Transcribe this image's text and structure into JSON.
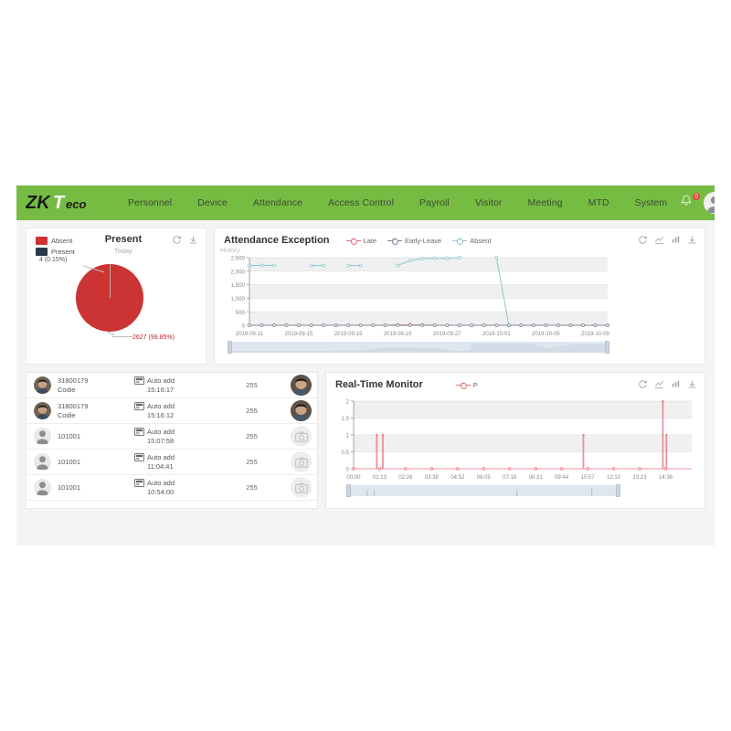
{
  "brand": {
    "name": "ZKTeco",
    "green": "#76bc43"
  },
  "nav": {
    "items": [
      {
        "label": "Personnel"
      },
      {
        "label": "Device"
      },
      {
        "label": "Attendance"
      },
      {
        "label": "Access Control"
      },
      {
        "label": "Payroll"
      },
      {
        "label": "Visitor"
      },
      {
        "label": "Meeting"
      },
      {
        "label": "MTD"
      },
      {
        "label": "System"
      }
    ],
    "notification_count": "0"
  },
  "present_card": {
    "title": "Present",
    "subtitle": "Today",
    "legend": [
      {
        "label": "Absent",
        "color": "#cc3333"
      },
      {
        "label": "Present",
        "color": "#2b3a4a"
      }
    ],
    "labels": {
      "small": "4 (0.15%)",
      "large": "2627 (99.85%)"
    },
    "tools": [
      "refresh-icon",
      "download-icon"
    ],
    "chart_data": {
      "type": "pie",
      "title": "Present",
      "labels": [
        "Present",
        "Absent"
      ],
      "values": [
        4,
        2627
      ],
      "percents": [
        0.15,
        99.85
      ],
      "colors": [
        "#2b3a4a",
        "#cc3333"
      ],
      "legend_position": "top-left"
    }
  },
  "exception_card": {
    "title": "Attendance Exception",
    "history_label": "History",
    "legend": [
      {
        "label": "Late",
        "color": "#e4717a"
      },
      {
        "label": "Early-Leave",
        "color": "#7b8794"
      },
      {
        "label": "Absent",
        "color": "#8fc6cf"
      }
    ],
    "tools": [
      "refresh-icon",
      "line-chart-icon",
      "bar-chart-icon",
      "download-icon"
    ],
    "chart_data": {
      "type": "line",
      "title": "Attendance Exception",
      "xlabel": "",
      "ylabel": "",
      "ylim": [
        0,
        2500
      ],
      "yticks": [
        0,
        500,
        1000,
        1500,
        2000,
        2500
      ],
      "ytick_labels": [
        "0",
        "500",
        "1,000",
        "1,500",
        "2,000",
        "2,500"
      ],
      "grid": true,
      "legend_position": "top-center",
      "x": [
        "2019-09-11",
        "2019-09-12",
        "2019-09-13",
        "2019-09-14",
        "2019-09-15",
        "2019-09-16",
        "2019-09-17",
        "2019-09-18",
        "2019-09-19",
        "2019-09-20",
        "2019-09-21",
        "2019-09-22",
        "2019-09-23",
        "2019-09-24",
        "2019-09-25",
        "2019-09-26",
        "2019-09-27",
        "2019-09-28",
        "2019-09-29",
        "2019-09-30",
        "2019-10-01",
        "2019-10-02",
        "2019-10-03",
        "2019-10-04",
        "2019-10-05",
        "2019-10-06",
        "2019-10-07",
        "2019-10-08",
        "2019-10-09",
        "2019-10-10"
      ],
      "xtick_labels": [
        "2019-09-11",
        "2019-09-15",
        "2019-09-19",
        "2019-09-23",
        "2019-09-27",
        "2019-10-01",
        "2019-10-05",
        "2019-10-09"
      ],
      "series": [
        {
          "name": "Absent",
          "color": "#8fc6cf",
          "values": [
            2210,
            2215,
            2212,
            null,
            null,
            2212,
            2210,
            null,
            2210,
            2212,
            null,
            null,
            2215,
            2390,
            2470,
            2480,
            2478,
            2500,
            null,
            null,
            2500,
            0,
            0,
            0,
            0,
            0,
            0,
            0,
            0,
            0
          ]
        },
        {
          "name": "Late",
          "color": "#e4717a",
          "values": [
            0,
            0,
            0,
            0,
            0,
            0,
            0,
            0,
            0,
            0,
            0,
            0,
            12,
            14,
            10,
            0,
            0,
            0,
            0,
            0,
            0,
            0,
            0,
            0,
            0,
            0,
            0,
            0,
            0,
            0
          ]
        },
        {
          "name": "Early-Leave",
          "color": "#7b8794",
          "values": [
            0,
            0,
            0,
            0,
            0,
            0,
            0,
            0,
            0,
            0,
            0,
            0,
            0,
            0,
            0,
            0,
            0,
            0,
            0,
            0,
            0,
            0,
            0,
            0,
            0,
            0,
            0,
            0,
            0,
            0
          ]
        }
      ]
    }
  },
  "realtime_card": {
    "title": "Real-Time Monitor",
    "legend": [
      {
        "label": "P",
        "color": "#e4717a"
      }
    ],
    "tools": [
      "refresh-icon",
      "line-chart-icon",
      "bar-chart-icon",
      "download-icon"
    ],
    "chart_data": {
      "type": "line",
      "title": "Real-Time Monitor",
      "xlabel": "",
      "ylabel": "",
      "ylim": [
        0,
        2
      ],
      "yticks": [
        0,
        0.5,
        1,
        1.5,
        2
      ],
      "ytick_labels": [
        "0",
        "0.5",
        "1",
        "1.5",
        "2"
      ],
      "grid": true,
      "legend_position": "top-center",
      "xtick_labels": [
        "00:00",
        "01:13",
        "02:26",
        "03:39",
        "04:52",
        "06:05",
        "07:18",
        "08:31",
        "09:44",
        "10:57",
        "12:10",
        "13:23",
        "14:36"
      ],
      "series": [
        {
          "name": "P",
          "color": "#e4717a",
          "spikes": [
            {
              "time": "01:05",
              "value": 1
            },
            {
              "time": "01:22",
              "value": 1
            },
            {
              "time": "10:45",
              "value": 1
            },
            {
              "time": "14:28",
              "value": 2
            },
            {
              "time": "14:38",
              "value": 1
            }
          ]
        }
      ]
    }
  },
  "attendance_list": {
    "rows": [
      {
        "id": "31800179",
        "name": "Codie",
        "event": "Auto add",
        "time": "15:16:17",
        "code": "255",
        "has_photo": true
      },
      {
        "id": "31800179",
        "name": "Codie",
        "event": "Auto add",
        "time": "15:16:12",
        "code": "255",
        "has_photo": true
      },
      {
        "id": "101001",
        "name": "",
        "event": "Auto add",
        "time": "15:07:58",
        "code": "255",
        "has_photo": false
      },
      {
        "id": "101001",
        "name": "",
        "event": "Auto add",
        "time": "11:04:41",
        "code": "255",
        "has_photo": false
      },
      {
        "id": "101001",
        "name": "",
        "event": "Auto add",
        "time": "10:54:00",
        "code": "255",
        "has_photo": false
      }
    ]
  }
}
